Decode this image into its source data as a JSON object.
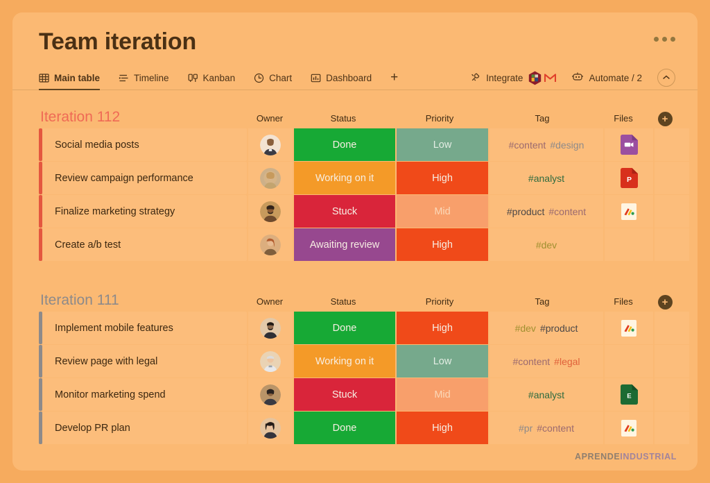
{
  "header": {
    "title": "Team iteration",
    "kebab_name": "more-options",
    "tabs": [
      {
        "label": "Main table",
        "icon": "table-icon",
        "active": true
      },
      {
        "label": "Timeline",
        "icon": "timeline-icon",
        "active": false
      },
      {
        "label": "Kanban",
        "icon": "kanban-icon",
        "active": false
      },
      {
        "label": "Chart",
        "icon": "clock-icon",
        "active": false
      },
      {
        "label": "Dashboard",
        "icon": "bar-chart-icon",
        "active": false
      }
    ],
    "add_tab_label": "+",
    "integrate_label": "Integrate",
    "integrate_icon": "integrate-icon",
    "integration_badges": [
      "hexagon-badge-icon",
      "gmail-icon"
    ],
    "automate_label": "Automate / 2",
    "automate_icon": "robot-icon",
    "collapse_icon": "chevron-up-icon"
  },
  "columns": {
    "owner": "Owner",
    "status": "Status",
    "priority": "Priority",
    "tag": "Tag",
    "files": "Files",
    "add": "+"
  },
  "colors": {
    "page_background": "#f6ab5e",
    "card_background": "#fbb973",
    "cell_background": "#fcbd7b",
    "title_text": "#4a3014",
    "group_112": "#ef6a55",
    "group_111": "#8d8a8a",
    "status_done": "#17a935",
    "status_working": "#f49a28",
    "status_stuck": "#d9253a",
    "status_awaiting": "#97488f",
    "priority_high": "#f04a19",
    "priority_mid": "#f89f6b",
    "priority_low": "#76a98c"
  },
  "groups": [
    {
      "title": "Iteration 112",
      "title_class": "c-red",
      "bar_class": "cb-red",
      "rows": [
        {
          "name": "Social media posts",
          "owner": "avatar-woman-1",
          "status": {
            "label": "Done",
            "class": "s-done"
          },
          "priority": {
            "label": "Low",
            "class": "p-low"
          },
          "tags": [
            {
              "label": "#content",
              "class": "t-content"
            },
            {
              "label": "#design",
              "class": "t-design"
            }
          ],
          "file": {
            "type": "video-file-icon",
            "letter": ""
          }
        },
        {
          "name": "Review campaign performance",
          "owner": "avatar-woman-2",
          "status": {
            "label": "Working on it",
            "class": "s-working"
          },
          "priority": {
            "label": "High",
            "class": "p-high"
          },
          "tags": [
            {
              "label": "#analyst",
              "class": "t-analyst"
            }
          ],
          "file": {
            "type": "powerpoint-file-icon",
            "letter": "P"
          }
        },
        {
          "name": "Finalize marketing strategy",
          "owner": "avatar-man-1",
          "status": {
            "label": "Stuck",
            "class": "s-stuck"
          },
          "priority": {
            "label": "Mid",
            "class": "p-mid"
          },
          "tags": [
            {
              "label": "#product",
              "class": "t-product"
            },
            {
              "label": "#content",
              "class": "t-content"
            }
          ],
          "file": {
            "type": "image-thumb-icon",
            "letter": ""
          }
        },
        {
          "name": "Create a/b test",
          "owner": "avatar-woman-3",
          "status": {
            "label": "Awaiting review",
            "class": "s-review"
          },
          "priority": {
            "label": "High",
            "class": "p-high"
          },
          "tags": [
            {
              "label": "#dev",
              "class": "t-dev"
            }
          ],
          "file": null
        }
      ]
    },
    {
      "title": "Iteration 111",
      "title_class": "c-slate",
      "bar_class": "cb-slate",
      "rows": [
        {
          "name": "Implement mobile features",
          "owner": "avatar-man-2",
          "status": {
            "label": "Done",
            "class": "s-done"
          },
          "priority": {
            "label": "High",
            "class": "p-high"
          },
          "tags": [
            {
              "label": "#dev",
              "class": "t-dev"
            },
            {
              "label": "#product",
              "class": "t-product"
            }
          ],
          "file": {
            "type": "image-thumb-icon",
            "letter": ""
          }
        },
        {
          "name": "Review page with legal",
          "owner": "avatar-man-3",
          "status": {
            "label": "Working on it",
            "class": "s-working"
          },
          "priority": {
            "label": "Low",
            "class": "p-low"
          },
          "tags": [
            {
              "label": "#content",
              "class": "t-content"
            },
            {
              "label": "#legal",
              "class": "t-legal"
            }
          ],
          "file": null
        },
        {
          "name": "Monitor marketing spend",
          "owner": "avatar-woman-4",
          "status": {
            "label": "Stuck",
            "class": "s-stuck"
          },
          "priority": {
            "label": "Mid",
            "class": "p-mid"
          },
          "tags": [
            {
              "label": "#analyst",
              "class": "t-analyst"
            }
          ],
          "file": {
            "type": "excel-file-icon",
            "letter": "E"
          }
        },
        {
          "name": "Develop PR plan",
          "owner": "avatar-woman-5",
          "status": {
            "label": "Done",
            "class": "s-done"
          },
          "priority": {
            "label": "High",
            "class": "p-high"
          },
          "tags": [
            {
              "label": "#pr",
              "class": "t-pr"
            },
            {
              "label": "#content",
              "class": "t-content"
            }
          ],
          "file": {
            "type": "image-thumb-icon",
            "letter": ""
          }
        }
      ]
    }
  ],
  "watermark": {
    "part_a": "APRENDE",
    "part_b": "INDUSTRIAL"
  }
}
